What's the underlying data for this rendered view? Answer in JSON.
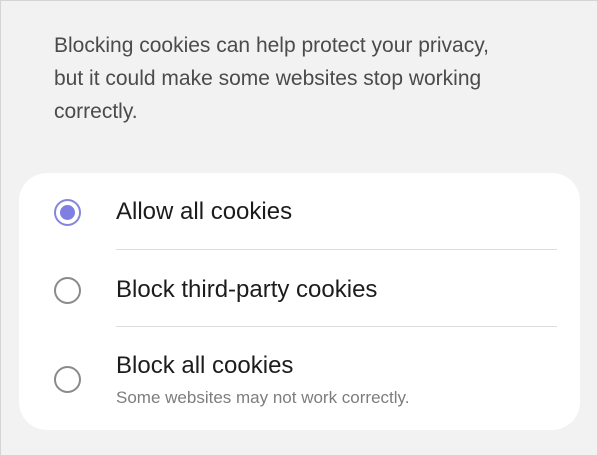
{
  "description": {
    "line1": "Blocking cookies can help protect your privacy,",
    "line2": "but it could make some websites stop working",
    "line3": "correctly."
  },
  "options": [
    {
      "label": "Allow all cookies",
      "selected": true
    },
    {
      "label": "Block third-party cookies",
      "selected": false
    },
    {
      "label": "Block all cookies",
      "sublabel": "Some websites may not work correctly.",
      "selected": false
    }
  ],
  "colors": {
    "background": "#f2f2f2",
    "card": "#ffffff",
    "accent": "#7f7fe3",
    "text_primary": "#1c1c1c",
    "text_secondary": "#7d7d7d"
  }
}
